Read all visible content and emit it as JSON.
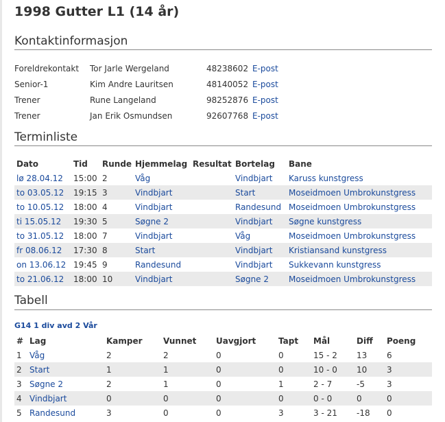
{
  "page_title": "1998 Gutter L1 (14 år)",
  "contacts": {
    "title": "Kontaktinformasjon",
    "rows": [
      {
        "role": "Foreldrekontakt",
        "name": "Tor Jarle Wergeland",
        "phone": "48238602",
        "email_label": "E-post"
      },
      {
        "role": "Senior-1",
        "name": "Kim Andre Lauritsen",
        "phone": "48140052",
        "email_label": "E-post"
      },
      {
        "role": "Trener",
        "name": "Rune Langeland",
        "phone": "98252876",
        "email_label": "E-post"
      },
      {
        "role": "Trener",
        "name": "Jan Erik Osmundsen",
        "phone": "92607768",
        "email_label": "E-post"
      }
    ]
  },
  "fixtures": {
    "title": "Terminliste",
    "headers": [
      "Dato",
      "Tid",
      "Runde",
      "Hjemmelag",
      "Resultat",
      "Bortelag",
      "Bane"
    ],
    "rows": [
      {
        "date": "lø 28.04.12",
        "time": "15:00",
        "round": "2",
        "home": "Våg",
        "result": "",
        "away": "Vindbjart",
        "venue": "Karuss kunstgress"
      },
      {
        "date": "to 03.05.12",
        "time": "19:15",
        "round": "3",
        "home": "Vindbjart",
        "result": "",
        "away": "Start",
        "venue": "Moseidmoen Umbrokunstgress"
      },
      {
        "date": "to 10.05.12",
        "time": "18:00",
        "round": "4",
        "home": "Vindbjart",
        "result": "",
        "away": "Randesund",
        "venue": "Moseidmoen Umbrokunstgress"
      },
      {
        "date": "ti 15.05.12",
        "time": "19:30",
        "round": "5",
        "home": "Søgne 2",
        "result": "",
        "away": "Vindbjart",
        "venue": "Søgne kunstgress"
      },
      {
        "date": "to 31.05.12",
        "time": "18:00",
        "round": "7",
        "home": "Vindbjart",
        "result": "",
        "away": "Våg",
        "venue": "Moseidmoen Umbrokunstgress"
      },
      {
        "date": "fr 08.06.12",
        "time": "17:30",
        "round": "8",
        "home": "Start",
        "result": "",
        "away": "Vindbjart",
        "venue": "Kristiansand kunstgress"
      },
      {
        "date": "on 13.06.12",
        "time": "19:45",
        "round": "9",
        "home": "Randesund",
        "result": "",
        "away": "Vindbjart",
        "venue": "Sukkevann kunstgress"
      },
      {
        "date": "to 21.06.12",
        "time": "18:00",
        "round": "10",
        "home": "Vindbjart",
        "result": "",
        "away": "Søgne 2",
        "venue": "Moseidmoen Umbrokunstgress"
      }
    ]
  },
  "standings": {
    "title": "Tabell",
    "group": "G14 1 div avd 2 Vår",
    "headers": [
      "#",
      "Lag",
      "Kamper",
      "Vunnet",
      "Uavgjort",
      "Tapt",
      "Mål",
      "Diff",
      "Poeng"
    ],
    "rows": [
      {
        "pos": "1",
        "team": "Våg",
        "played": "2",
        "won": "2",
        "drawn": "0",
        "lost": "0",
        "goals": "15 - 2",
        "diff": "13",
        "points": "6"
      },
      {
        "pos": "2",
        "team": "Start",
        "played": "1",
        "won": "1",
        "drawn": "0",
        "lost": "0",
        "goals": "10 - 0",
        "diff": "10",
        "points": "3"
      },
      {
        "pos": "3",
        "team": "Søgne 2",
        "played": "2",
        "won": "1",
        "drawn": "0",
        "lost": "1",
        "goals": "2 - 7",
        "diff": "-5",
        "points": "3"
      },
      {
        "pos": "4",
        "team": "Vindbjart",
        "played": "0",
        "won": "0",
        "drawn": "0",
        "lost": "0",
        "goals": "0 - 0",
        "diff": "0",
        "points": "0"
      },
      {
        "pos": "5",
        "team": "Randesund",
        "played": "3",
        "won": "0",
        "drawn": "0",
        "lost": "3",
        "goals": "3 - 21",
        "diff": "-18",
        "points": "0"
      }
    ]
  }
}
